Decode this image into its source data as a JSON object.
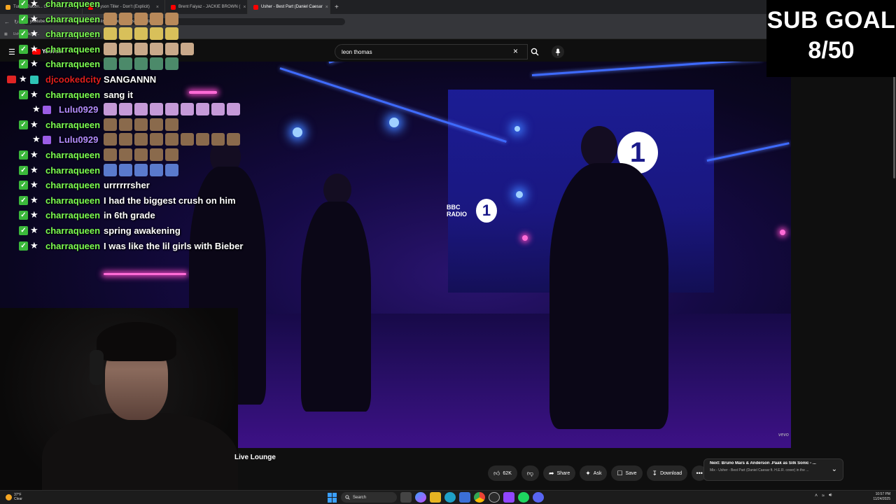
{
  "browser": {
    "tabs": [
      {
        "label": "Turkey Bacon... GF · Trivia &...",
        "active": false,
        "icon_color": "#f5a623"
      },
      {
        "label": "Bryson Tiller - Don't (Explicit)",
        "active": false,
        "icon_color": "#ff0000"
      },
      {
        "label": "Brent Faiyaz - JACKIE BROWN (",
        "active": false,
        "icon_color": "#ff0000"
      },
      {
        "label": "Usher - Best Part (Daniel Caesar",
        "active": true,
        "icon_color": "#ff0000"
      }
    ],
    "new_tab": "+",
    "url": "youtube.com/watch?v=...swizB...MM&list=...&index=1&start_radio=1",
    "bookmarks": [
      "Usher's playlist..."
    ]
  },
  "youtube": {
    "logo_text": "YouTube",
    "search_value": "leon thomas",
    "video_title": "Usher - Best Part (Daniel Caesar ft. H.E.R. cover) in the Live Lounge",
    "video_title_visible": "Live Lounge",
    "actions": {
      "likes": "62K",
      "share": "Share",
      "ask": "Ask",
      "save": "Save",
      "download": "Download",
      "more": "•••"
    },
    "next": {
      "title": "Next: Bruno Mars & Anderson .Paak as Silk Sonic - ...",
      "subtitle": "Mix - Usher - Best Part (Daniel Caesar ft. H.E.R. cover) in the ..."
    },
    "watermark": "vevo",
    "video_logo_text": "BBC RADIO",
    "video_logo_num": "1"
  },
  "stream_overlay": {
    "sub_goal_title": "SUB GOAL",
    "sub_goal_count": "8/50",
    "sub_goal_progress": 0.16
  },
  "chat": [
    {
      "user": "charraqueen",
      "color": "#7cfc52",
      "text": "",
      "emotes": 0,
      "badges": [
        "sub",
        "star"
      ],
      "emote_color": ""
    },
    {
      "user": "charraqueen",
      "color": "#7cfc52",
      "text": "",
      "emotes": 5,
      "badges": [
        "sub",
        "star"
      ],
      "emote_color": "#b8895a"
    },
    {
      "user": "charraqueen",
      "color": "#7cfc52",
      "text": "",
      "emotes": 5,
      "badges": [
        "sub",
        "star"
      ],
      "emote_color": "#d8c05a"
    },
    {
      "user": "charraqueen",
      "color": "#7cfc52",
      "text": "",
      "emotes": 6,
      "badges": [
        "sub",
        "star"
      ],
      "emote_color": "#c9a98a"
    },
    {
      "user": "charraqueen",
      "color": "#7cfc52",
      "text": "",
      "emotes": 5,
      "badges": [
        "sub",
        "star"
      ],
      "emote_color": "#4c8a6a"
    },
    {
      "user": "djcookedcity",
      "color": "#e01e1e",
      "text": "SANGANNN",
      "emotes": 0,
      "badges": [
        "red",
        "star",
        "gift"
      ],
      "emote_color": ""
    },
    {
      "user": "charraqueen",
      "color": "#7cfc52",
      "text": "sang it",
      "emotes": 0,
      "badges": [
        "sub",
        "star"
      ],
      "emote_color": ""
    },
    {
      "user": "Lulu0929",
      "color": "#b48cff",
      "text": "",
      "emotes": 9,
      "badges": [
        "star",
        "purple"
      ],
      "emote_color": "#c59ad8"
    },
    {
      "user": "charraqueen",
      "color": "#7cfc52",
      "text": "",
      "emotes": 5,
      "badges": [
        "sub",
        "star"
      ],
      "emote_color": "#8a6a4c"
    },
    {
      "user": "Lulu0929",
      "color": "#b48cff",
      "text": "",
      "emotes": 9,
      "badges": [
        "star",
        "purple"
      ],
      "emote_color": "#8a6a4c"
    },
    {
      "user": "charraqueen",
      "color": "#7cfc52",
      "text": "",
      "emotes": 5,
      "badges": [
        "sub",
        "star"
      ],
      "emote_color": "#8a6a4c"
    },
    {
      "user": "charraqueen",
      "color": "#7cfc52",
      "text": "",
      "emotes": 5,
      "badges": [
        "sub",
        "star"
      ],
      "emote_color": "#5a7acc"
    },
    {
      "user": "charraqueen",
      "color": "#7cfc52",
      "text": "urrrrrrsher",
      "emotes": 0,
      "badges": [
        "sub",
        "star"
      ],
      "emote_color": ""
    },
    {
      "user": "charraqueen",
      "color": "#7cfc52",
      "text": "I had the biggest crush on him",
      "emotes": 0,
      "badges": [
        "sub",
        "star"
      ],
      "emote_color": ""
    },
    {
      "user": "charraqueen",
      "color": "#7cfc52",
      "text": "in 6th grade",
      "emotes": 0,
      "badges": [
        "sub",
        "star"
      ],
      "emote_color": ""
    },
    {
      "user": "charraqueen",
      "color": "#7cfc52",
      "text": "spring awakening",
      "emotes": 0,
      "badges": [
        "sub",
        "star"
      ],
      "emote_color": ""
    },
    {
      "user": "charraqueen",
      "color": "#7cfc52",
      "text": "I was like the lil girls with Bieber",
      "emotes": 0,
      "badges": [
        "sub",
        "star"
      ],
      "emote_color": ""
    }
  ],
  "taskbar": {
    "weather_temp": "37°F",
    "weather_desc": "Clear",
    "search_label": "Search",
    "time": "10:57 PM",
    "date": "11/24/2025"
  }
}
